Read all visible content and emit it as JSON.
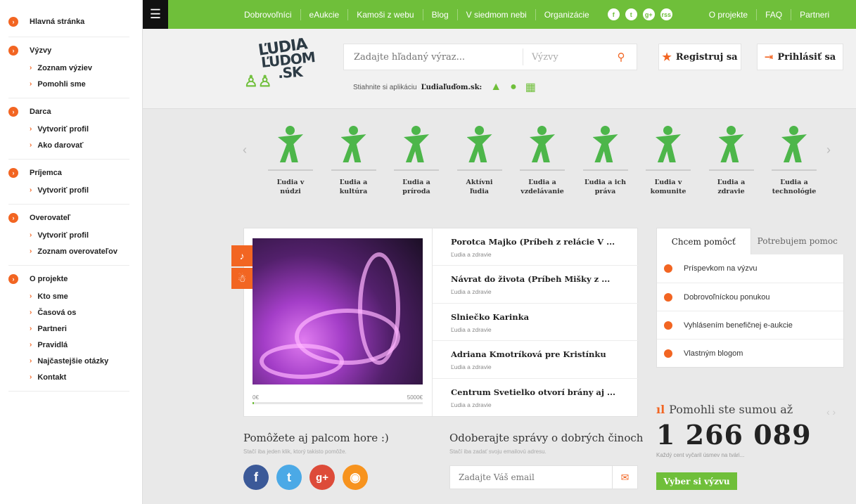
{
  "sidebar": {
    "groups": [
      {
        "title": "Hlavná stránka",
        "items": []
      },
      {
        "title": "Výzvy",
        "items": [
          "Zoznam výziev",
          "Pomohli sme"
        ]
      },
      {
        "title": "Darca",
        "items": [
          "Vytvoriť profil",
          "Ako darovať"
        ]
      },
      {
        "title": "Príjemca",
        "items": [
          "Vytvoriť profil"
        ]
      },
      {
        "title": "Overovateľ",
        "items": [
          "Vytvoriť profil",
          "Zoznam overovateľov"
        ]
      },
      {
        "title": "O projekte",
        "items": [
          "Kto sme",
          "Časová os",
          "Partneri",
          "Pravidlá",
          "Najčastejšie otázky",
          "Kontakt"
        ]
      }
    ]
  },
  "topnav": {
    "left": [
      "Dobrovoľníci",
      "eAukcie",
      "Kamoši z webu",
      "Blog",
      "V siedmom nebi",
      "Organizácie"
    ],
    "right": [
      "O projekte",
      "FAQ",
      "Partneri"
    ],
    "social": [
      "f",
      "t",
      "g+",
      "rss"
    ]
  },
  "header": {
    "logo": {
      "line1": "ĽUDIA",
      "line2": "ĽUDOM",
      "line3": ".SK"
    },
    "search_placeholder": "Zadajte hľadaný výraz...",
    "search_select": "Výzvy",
    "app_text": "Stiahnite si aplikáciu",
    "app_name": "Ľudiaľuďom.sk:",
    "register": "Registruj sa",
    "login": "Prihlásiť sa"
  },
  "categories": [
    "Ľudia v\nnúdzi",
    "Ľudia a\nkultúra",
    "Ľudia a\npríroda",
    "Aktívni\nľudia",
    "Ľudia a\nvzdelávanie",
    "Ľudia a ich\npráva",
    "Ľudia v\nkomunite",
    "Ľudia a\nzdravie",
    "Ľudia a\ntechnológie"
  ],
  "feature": {
    "progress_min": "0€",
    "progress_max": "5000€",
    "progress_fraction": 0.01,
    "items": [
      {
        "title": "Porotca Majko (Príbeh z relácie V ...",
        "sub": "Ľudia a zdravie"
      },
      {
        "title": "Návrat do života (Príbeh Mišky z ...",
        "sub": "Ľudia a zdravie"
      },
      {
        "title": "Slniečko Karinka",
        "sub": "Ľudia a zdravie"
      },
      {
        "title": "Adriana Kmotríková pre Kristínku",
        "sub": "Ľudia a zdravie"
      },
      {
        "title": "Centrum Svetielko otvorí brány aj ...",
        "sub": "Ľudia a zdravie"
      }
    ]
  },
  "help": {
    "tab_active": "Chcem pomôcť",
    "tab_inactive": "Potrebujem pomoc",
    "items": [
      "Príspevkom na výzvu",
      "Dobrovoľníckou ponukou",
      "Vyhlásením benefičnej e-aukcie",
      "Vlastným blogom"
    ]
  },
  "sum": {
    "label": "Pomohli ste sumou až",
    "value": "1 266 089",
    "note": "Každý cent vyčaril úsmev na tvári...",
    "cta": "Vyber si výzvu"
  },
  "bottom": {
    "like_title": "Pomôžete aj palcom hore :)",
    "like_sub": "Stačí iba jeden klik, ktorý takisto pomôže.",
    "news_title": "Odoberajte správy o dobrých činoch",
    "news_sub": "Stačí iba zadať svoju emailovú adresu.",
    "email_placeholder": "Zadajte Váš email"
  },
  "colors": {
    "green": "#6fbf3a",
    "orange": "#f26522",
    "facebook": "#3b5998",
    "twitter": "#4ba9e6",
    "gplus": "#dd4b39",
    "rss": "#f7931e"
  }
}
